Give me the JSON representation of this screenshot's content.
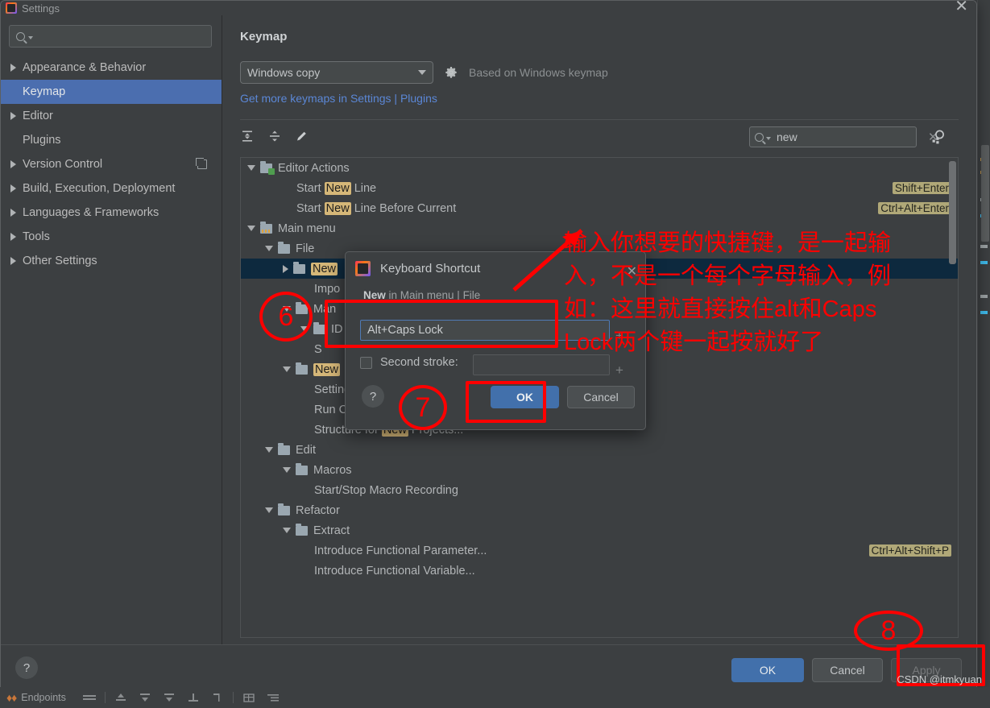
{
  "window": {
    "title": "Settings",
    "close_label": "✕"
  },
  "sidebar": {
    "search_placeholder": "",
    "search_value": "",
    "items": [
      {
        "label": "Appearance & Behavior",
        "expandable": true,
        "selected": false,
        "badge": false
      },
      {
        "label": "Keymap",
        "expandable": false,
        "selected": true,
        "badge": false
      },
      {
        "label": "Editor",
        "expandable": true,
        "selected": false,
        "badge": false
      },
      {
        "label": "Plugins",
        "expandable": false,
        "selected": false,
        "badge": false
      },
      {
        "label": "Version Control",
        "expandable": true,
        "selected": false,
        "badge": true
      },
      {
        "label": "Build, Execution, Deployment",
        "expandable": true,
        "selected": false,
        "badge": false
      },
      {
        "label": "Languages & Frameworks",
        "expandable": true,
        "selected": false,
        "badge": false
      },
      {
        "label": "Tools",
        "expandable": true,
        "selected": false,
        "badge": false
      },
      {
        "label": "Other Settings",
        "expandable": true,
        "selected": false,
        "badge": false
      }
    ]
  },
  "main": {
    "panel_title": "Keymap",
    "keymap_select_value": "Windows copy",
    "based_on_text": "Based on Windows keymap",
    "link_text": "Get more keymaps in Settings | Plugins",
    "filter_value": "new",
    "filter_clear_label": "✕"
  },
  "keymap_tree": [
    {
      "indent": 0,
      "tri": "down",
      "icon": "folder-green",
      "text": "Editor Actions",
      "hl": "",
      "shortcut": "",
      "selected": false
    },
    {
      "indent": 2,
      "tri": "none",
      "icon": "none",
      "text": "Start |New| Line",
      "hl": "New",
      "shortcut": "Shift+Enter",
      "selected": false
    },
    {
      "indent": 2,
      "tri": "none",
      "icon": "none",
      "text": "Start |New| Line Before Current",
      "hl": "New",
      "shortcut": "Ctrl+Alt+Enter",
      "selected": false
    },
    {
      "indent": 0,
      "tri": "down",
      "icon": "folder-menu",
      "text": "Main menu",
      "hl": "",
      "shortcut": "",
      "selected": false
    },
    {
      "indent": 1,
      "tri": "down",
      "icon": "folder",
      "text": "File",
      "hl": "",
      "shortcut": "",
      "selected": false
    },
    {
      "indent": 2,
      "tri": "right",
      "icon": "folder",
      "text": "|New|",
      "hl": "New",
      "shortcut": "",
      "selected": true
    },
    {
      "indent": 3,
      "tri": "none",
      "icon": "none",
      "text": "Impo",
      "hl": "",
      "shortcut": "",
      "selected": false
    },
    {
      "indent": 2,
      "tri": "down",
      "icon": "folder",
      "text": "Man",
      "hl": "",
      "shortcut": "",
      "selected": false
    },
    {
      "indent": 3,
      "tri": "down",
      "icon": "folder",
      "text": "ID",
      "hl": "",
      "shortcut": "",
      "selected": false
    },
    {
      "indent": 3,
      "tri": "none",
      "icon": "none",
      "text": "S",
      "hl": "",
      "shortcut": "",
      "selected": false
    },
    {
      "indent": 2,
      "tri": "down",
      "icon": "folder",
      "text": "|New|",
      "hl": "New",
      "shortcut": "",
      "selected": false
    },
    {
      "indent": 3,
      "tri": "none",
      "icon": "none",
      "text": "Settings for |New| Projects...",
      "hl": "New",
      "shortcut": "",
      "selected": false
    },
    {
      "indent": 3,
      "tri": "none",
      "icon": "none",
      "text": "Run Configuration Templates for |New| Projects...",
      "hl": "New",
      "shortcut": "",
      "selected": false
    },
    {
      "indent": 3,
      "tri": "none",
      "icon": "none",
      "text": "Structure for |New| Projects...",
      "hl": "New",
      "shortcut": "",
      "selected": false
    },
    {
      "indent": 1,
      "tri": "down",
      "icon": "folder",
      "text": "Edit",
      "hl": "",
      "shortcut": "",
      "selected": false
    },
    {
      "indent": 2,
      "tri": "down",
      "icon": "folder",
      "text": "Macros",
      "hl": "",
      "shortcut": "",
      "selected": false
    },
    {
      "indent": 3,
      "tri": "none",
      "icon": "none",
      "text": "Start/Stop Macro Recording",
      "hl": "",
      "shortcut": "",
      "selected": false
    },
    {
      "indent": 1,
      "tri": "down",
      "icon": "folder",
      "text": "Refactor",
      "hl": "",
      "shortcut": "",
      "selected": false
    },
    {
      "indent": 2,
      "tri": "down",
      "icon": "folder",
      "text": "Extract",
      "hl": "",
      "shortcut": "",
      "selected": false
    },
    {
      "indent": 3,
      "tri": "none",
      "icon": "none",
      "text": "Introduce Functional Parameter...",
      "hl": "",
      "shortcut": "Ctrl+Alt+Shift+P",
      "selected": false
    },
    {
      "indent": 3,
      "tri": "none",
      "icon": "none",
      "text": "Introduce Functional Variable...",
      "hl": "",
      "shortcut": "",
      "selected": false
    }
  ],
  "dialog": {
    "title": "Keyboard Shortcut",
    "close_label": "✕",
    "caption_bold": "New",
    "caption_rest": " in Main menu | File",
    "shortcut_value": "Alt+Caps Lock",
    "second_stroke_label": "Second stroke:",
    "second_stroke_value": "",
    "plus_label": "+",
    "help_label": "?",
    "ok_label": "OK",
    "cancel_label": "Cancel"
  },
  "footer": {
    "help_label": "?",
    "ok_label": "OK",
    "cancel_label": "Cancel",
    "apply_label": "Apply"
  },
  "statusbar": {
    "endpoints_label": "Endpoints"
  },
  "annotations": {
    "step6": "6",
    "step7": "7",
    "step8": "8",
    "note": "输入你想要的快捷键，是一起输\n入，不是一个每个字母输入，例\n如：这里就直接按住alt和Caps\nLock两个键一起按就好了",
    "watermark": "CSDN @itmkyuan",
    "accent_color": "#ff0000"
  },
  "colors": {
    "selection_blue": "#4b6eaf",
    "tree_selection": "#0d293e",
    "highlight_yellow": "#d5b778",
    "shortcut_yellow": "#b0a878",
    "link_blue": "#5b87d6",
    "primary_button": "#4270ab"
  }
}
